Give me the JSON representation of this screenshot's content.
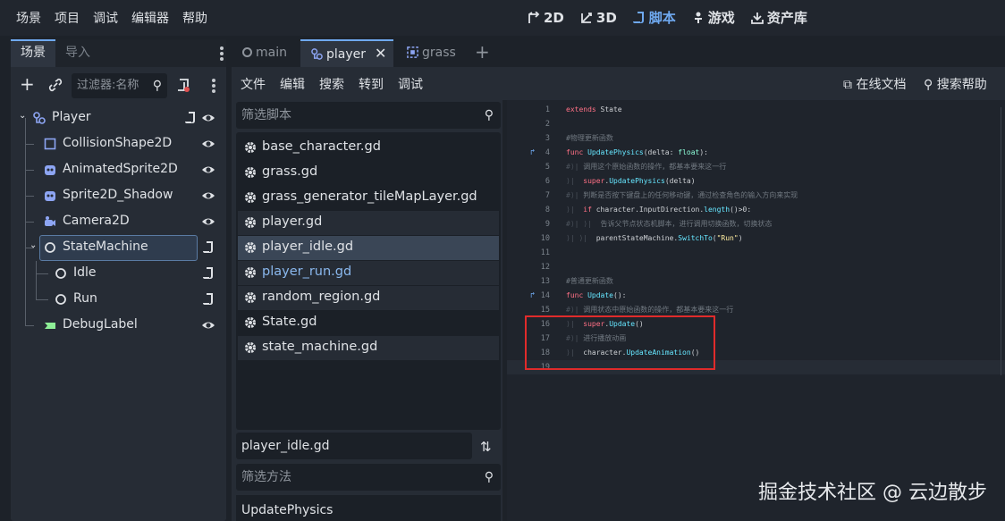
{
  "menu": [
    "场景",
    "项目",
    "调试",
    "编辑器",
    "帮助"
  ],
  "modes": [
    {
      "icon": "2d-icon",
      "label": "2D"
    },
    {
      "icon": "3d-icon",
      "label": "3D"
    },
    {
      "icon": "script-icon",
      "label": "脚本"
    },
    {
      "icon": "game-icon",
      "label": "游戏"
    },
    {
      "icon": "asset-library-icon",
      "label": "资产库"
    }
  ],
  "scene_dock": {
    "tabs": [
      "场景",
      "导入"
    ],
    "filter_placeholder": "过滤器:名称",
    "tree": [
      {
        "label": "Player",
        "icon": "node2d-icon",
        "icon_color": "#8da5f3",
        "has_script": true,
        "visible_toggle": true
      },
      {
        "label": "CollisionShape2D",
        "icon": "collision-shape-icon",
        "icon_color": "#8da5f3",
        "visible_toggle": true
      },
      {
        "label": "AnimatedSprite2D",
        "icon": "animated-sprite-icon",
        "icon_color": "#8da5f3",
        "visible_toggle": true
      },
      {
        "label": "Sprite2D_Shadow",
        "icon": "sprite-icon",
        "icon_color": "#8da5f3",
        "visible_toggle": true
      },
      {
        "label": "Camera2D",
        "icon": "camera-icon",
        "icon_color": "#8da5f3",
        "visible_toggle": true
      },
      {
        "label": "StateMachine",
        "icon": "node-icon",
        "icon_color": "#dfe2e6",
        "has_script": true
      },
      {
        "label": "Idle",
        "icon": "node-icon",
        "icon_color": "#dfe2e6",
        "has_script": true
      },
      {
        "label": "Run",
        "icon": "node-icon",
        "icon_color": "#dfe2e6",
        "has_script": true
      },
      {
        "label": "DebugLabel",
        "icon": "label-icon",
        "icon_color": "#8eef97",
        "visible_toggle": true
      }
    ]
  },
  "file_tabs": [
    {
      "label": "main",
      "icon": "circle-icon"
    },
    {
      "label": "player",
      "icon": "node2d-icon",
      "closable": true
    },
    {
      "label": "grass",
      "icon": "scene-icon"
    }
  ],
  "script_menu": [
    "文件",
    "编辑",
    "搜索",
    "转到",
    "调试"
  ],
  "script_menu_right": [
    "在线文档",
    "搜索帮助"
  ],
  "script_filter_placeholder": "筛选脚本",
  "scripts": [
    "base_character.gd",
    "grass.gd",
    "grass_generator_tileMapLayer.gd",
    "player.gd",
    "player_idle.gd",
    "player_run.gd",
    "random_region.gd",
    "State.gd",
    "state_machine.gd"
  ],
  "current_file": "player_idle.gd",
  "method_filter_placeholder": "筛选方法",
  "methods": [
    "UpdatePhysics"
  ],
  "code_lines": [
    {
      "n": "1",
      "html": "<span class='kw'>extends</span> State"
    },
    {
      "n": "2",
      "html": ""
    },
    {
      "n": "3",
      "html": "<span class='cm'>#物理更新函数</span>"
    },
    {
      "n": "4",
      "html": "<span class='kw'>func</span> <span class='fn'>UpdatePhysics</span>(delta: <span class='ty'>float</span>):"
    },
    {
      "n": "5",
      "html": "<span class='tabmark'>#⟩|</span> <span class='cm'>调用这个原始函数的操作，都基本要来这一行</span>"
    },
    {
      "n": "6",
      "html": "<span class='tabmark'>⟩|</span>  <span class='kw'>super</span>.<span class='fn'>UpdatePhysics</span>(delta)"
    },
    {
      "n": "7",
      "html": "<span class='tabmark'>#⟩|</span> <span class='cm'>判断是否按下键盘上的任何移动键，通过检查角色的输入方向来实现</span>"
    },
    {
      "n": "8",
      "html": "<span class='tabmark'>⟩|</span>  <span class='kw'>if</span> character.InputDirection.<span class='fn'>length</span>()&gt;0:"
    },
    {
      "n": "9",
      "html": "<span class='tabmark'>#⟩| ⟩|</span>  <span class='cm'>告诉父节点状态机脚本，进行调用切换函数，切换状态</span>"
    },
    {
      "n": "10",
      "html": "<span class='tabmark'>⟩| ⟩|</span>  parentStateMachine.<span class='fn'>SwitchTo</span>(<span class='str'>\"Run\"</span>)"
    },
    {
      "n": "11",
      "html": ""
    },
    {
      "n": "12",
      "html": ""
    },
    {
      "n": "13",
      "html": "<span class='cm'>#普通更新函数</span>"
    },
    {
      "n": "14",
      "html": "<span class='kw'>func</span> <span class='fn'>Update</span>():"
    },
    {
      "n": "15",
      "html": "<span class='tabmark'>#⟩|</span> <span class='cm'>调用状态中原始函数的操作，都基本要来这一行</span>"
    },
    {
      "n": "16",
      "html": "<span class='tabmark'>⟩|</span>  <span class='kw'>super</span>.<span class='fn'>Update</span>()"
    },
    {
      "n": "17",
      "html": "<span class='tabmark'>#⟩|</span> <span class='cm'>进行播放动画</span>"
    },
    {
      "n": "18",
      "html": "<span class='tabmark'>⟩|</span>  character.<span class='fn'>UpdateAnimation</span>()"
    },
    {
      "n": "19",
      "html": ""
    }
  ],
  "watermark": "掘金技术社区 @ 云边散步"
}
